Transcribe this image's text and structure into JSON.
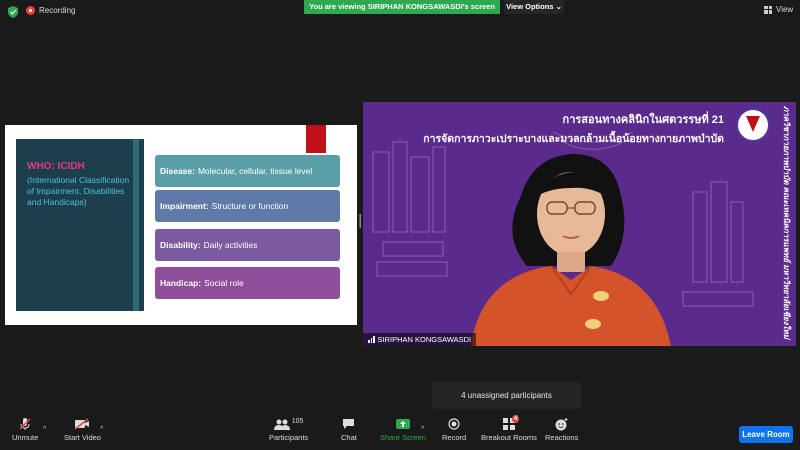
{
  "topbar": {
    "recording_label": "Recording",
    "viewing_banner": "You are viewing SIRIPHAN KONGSAWASDI's screen",
    "view_options": "View Options",
    "view_label": "View",
    "banner_color": "#2ea94f"
  },
  "slide": {
    "who_title": "WHO: ICIDH",
    "who_body": "(International Classification of Impairment, Disabilities and Handicaps)",
    "boxes": [
      {
        "term": "Disease:",
        "desc": "Molecular, cellular, tissue level"
      },
      {
        "term": "Impairment:",
        "desc": "Structure or function"
      },
      {
        "term": "Disability:",
        "desc": "Daily activities"
      },
      {
        "term": "Handicap:",
        "desc": "Social role"
      }
    ]
  },
  "video": {
    "title_line1": "การสอนทางคลินิกในศตวรรษที่ 21",
    "title_line2": "การจัดการภาวะเปราะบางและมวลกล้ามเนื้อน้อยทางกายภาพบำบัด",
    "vertical_text": "ภาควิชากายภาพบำบัด คณะเทคนิคการแพทย์ มหาวิทยาลัยเชียงใหม่",
    "participant_name": "SIRIPHAN KONGSAWASDI",
    "bg_color": "#5a2b8c"
  },
  "tooltip": "4 unassigned participants",
  "toolbar": {
    "unmute": "Unmute",
    "start_video": "Start Video",
    "participants": "Participants",
    "participants_count": "105",
    "chat": "Chat",
    "share_screen": "Share Screen",
    "record": "Record",
    "breakout_rooms": "Breakout Rooms",
    "breakout_badge": "4",
    "reactions": "Reactions",
    "leave_room": "Leave Room",
    "share_color": "#2ea94f",
    "leave_color": "#0e72ed"
  }
}
